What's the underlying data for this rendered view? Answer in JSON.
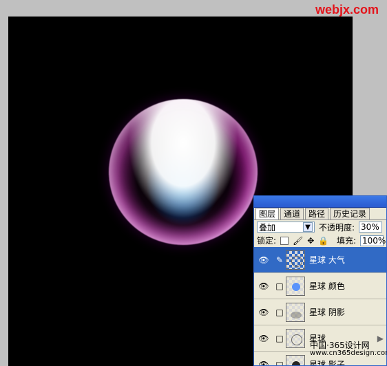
{
  "watermark_top": "webjx.com",
  "panel": {
    "tabs": [
      "图层",
      "通道",
      "路径",
      "历史记录"
    ],
    "blend": {
      "mode": "叠加",
      "opacity_label": "不透明度:",
      "opacity_value": "30%"
    },
    "lock": {
      "label": "锁定:",
      "fill_label": "填充:",
      "fill_value": "100%"
    },
    "layers": [
      {
        "name": "星球 大气",
        "selected": true,
        "thumb": "blur-dot"
      },
      {
        "name": "星球 颜色",
        "selected": false,
        "thumb": "blue-dot"
      },
      {
        "name": "星球 阴影",
        "selected": false,
        "thumb": "shadow"
      },
      {
        "name": "星球",
        "selected": false,
        "thumb": "ring"
      },
      {
        "name": "星球 影子",
        "selected": false,
        "thumb": "dark-dot"
      }
    ]
  },
  "watermark_bottom": {
    "cn": "中国·365设计网",
    "url": "www.cn365design.com"
  }
}
